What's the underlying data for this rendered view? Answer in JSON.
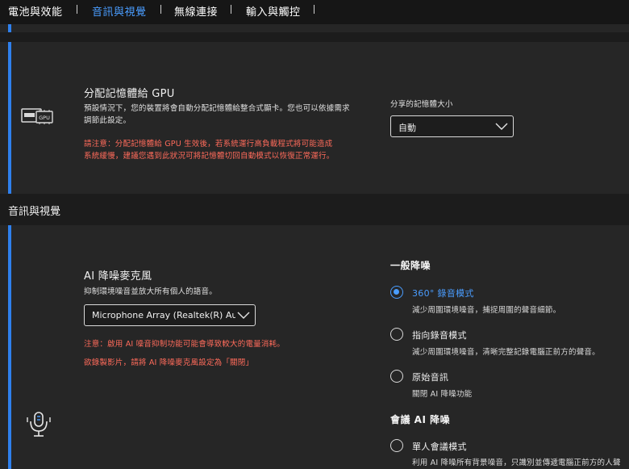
{
  "nav": {
    "items": [
      {
        "label": "電池與效能",
        "active": false
      },
      {
        "label": "音訊與視覺",
        "active": true
      },
      {
        "label": "無線連接",
        "active": false
      },
      {
        "label": "輸入與觸控",
        "active": false
      }
    ]
  },
  "gpu_memory": {
    "title": "分配記憶體給 GPU",
    "description_line1": "預設情況下，您的裝置將會自動分配記憶體給整合式顯卡。您也可以依據需求",
    "description_line2": "調節此設定。",
    "warning_line1": "請注意：分配記憶體給 GPU 生效後，若系統運行高負載程式將可能造成",
    "warning_line2": "系統緩慢，建議您遇到此狀況可將記憶體切回自動模式以恢復正常運行。",
    "shared_memory_label": "分享的記憶體大小",
    "shared_memory_value": "自動",
    "icon_text": "GPU"
  },
  "section": {
    "audio_visual_title": "音訊與視覺"
  },
  "ai_mic": {
    "title": "AI 降噪麥克風",
    "description": "抑制環境噪音並放大所有個人的語音。",
    "mic_select_value": "Microphone Array (Realtek(R) Audio)",
    "warning_line1": "注意：啟用 AI 噪音抑制功能可能會導致較大的電量消耗。",
    "warning_line2": "欲錄製影片，請將 AI 降噪麥克風設定為「關閉」",
    "general_title": "一般降噪",
    "options": [
      {
        "label": "360° 錄音模式",
        "desc": "減少周圍環境噪音，捕捉周圍的聲音細節。",
        "selected": true
      },
      {
        "label": "指向錄音模式",
        "desc": "減少周圍環境噪音，清晰完整記錄電腦正前方的聲音。",
        "selected": false
      },
      {
        "label": "原始音訊",
        "desc": "關閉 AI 降噪功能",
        "selected": false
      }
    ],
    "meeting_title": "會議 AI 降噪",
    "meeting_options": [
      {
        "label": "單人會議模式",
        "desc": "利用 AI 降噪所有背景噪音，只識別並傳遞電腦正前方的人聲",
        "selected": false
      }
    ]
  },
  "colors": {
    "accent": "#2f80ed",
    "active_tab": "#4a9dff",
    "warning": "#ff6b5b",
    "background": "#1c1c1c",
    "card": "#262626"
  }
}
